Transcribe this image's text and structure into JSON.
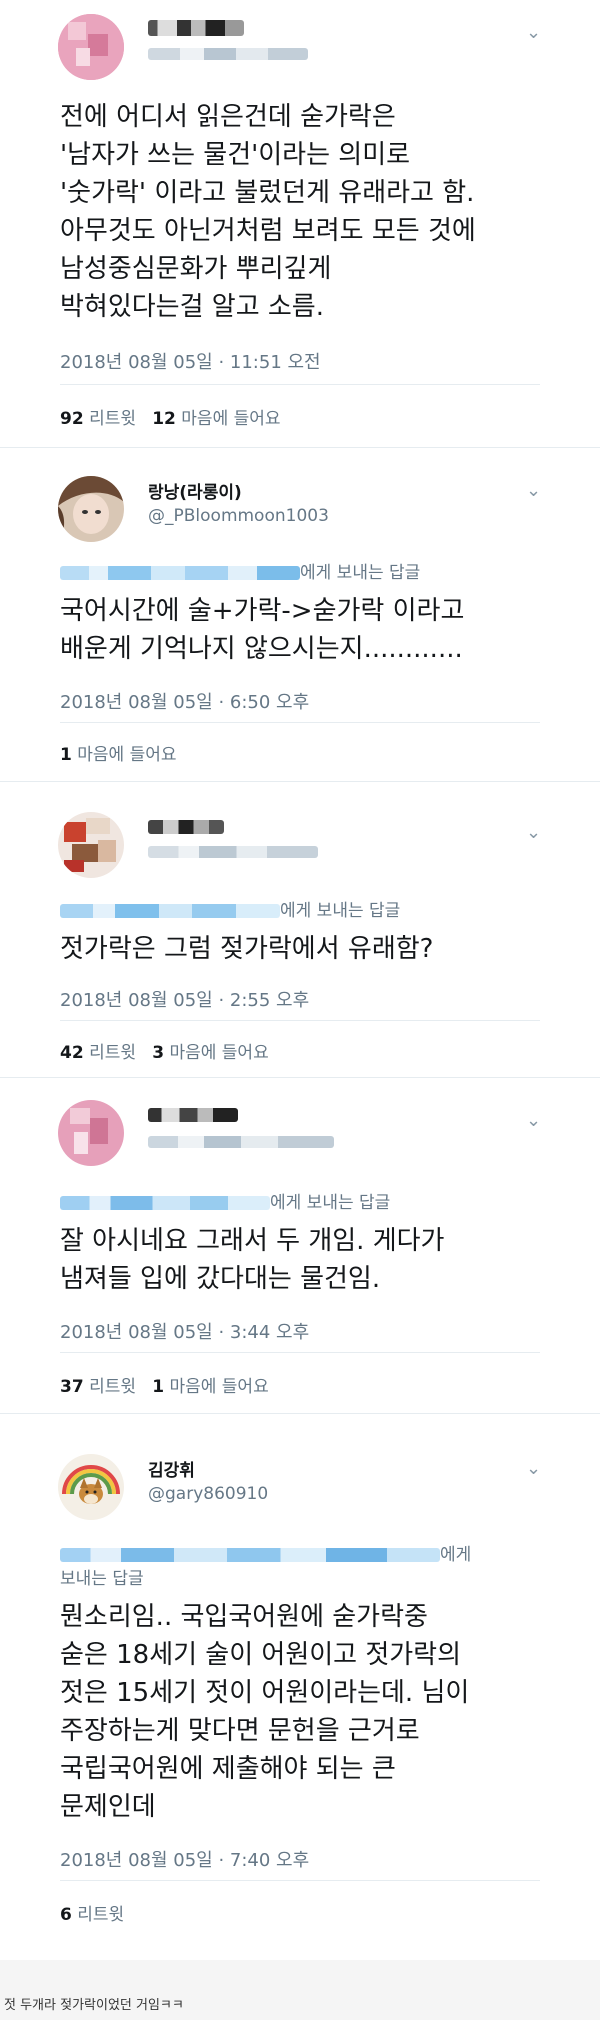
{
  "tweets": [
    {
      "name": "",
      "handle": "",
      "reply_to_suffix": "",
      "lines": [
        "전에 어디서 읽은건데 숟가락은",
        "'남자가 쓰는 물건'이라는 의미로",
        "'숫가락' 이라고 불렀던게 유래라고 함.",
        "아무것도 아닌거처럼 보려도 모든 것에",
        "남성중심문화가 뿌리깊게",
        "박혀있다는걸 알고 소름."
      ],
      "date": "2018년 08월 05일 · 11:51 오전",
      "retweets": "92",
      "retweets_label": "리트윗",
      "likes": "12",
      "likes_label": "마음에 들어요"
    },
    {
      "name": "랑낭(라롱이)",
      "handle": "@_PBloommoon1003",
      "reply_to_suffix": "에게 보내는 답글",
      "lines": [
        "국어시간에 술+가락->숟가락 이라고",
        "배운게 기억나지 않으시는지............"
      ],
      "date": "2018년 08월 05일 · 6:50 오후",
      "likes": "1",
      "likes_label": "마음에 들어요"
    },
    {
      "name": "",
      "handle": "",
      "reply_to_suffix": "에게 보내는 답글",
      "lines": [
        "젓가락은  그럼  젖가락에서 유래함?"
      ],
      "date": "2018년 08월 05일 · 2:55 오후",
      "retweets": "42",
      "retweets_label": "리트윗",
      "likes": "3",
      "likes_label": "마음에 들어요"
    },
    {
      "name": "",
      "handle": "",
      "reply_to_suffix": "에게 보내는 답글",
      "lines": [
        "잘 아시네요 그래서 두 개임. 게다가",
        "냄져들 입에 갔다대는 물건임."
      ],
      "date": "2018년 08월 05일 · 3:44 오후",
      "retweets": "37",
      "retweets_label": "리트윗",
      "likes": "1",
      "likes_label": "마음에 들어요"
    },
    {
      "name": "김강휘",
      "handle": "@gary860910",
      "reply_to_suffix": "에게",
      "reply_to_line2": "보내는 답글",
      "lines": [
        "뭔소리임.. 국입국어원에 숟가락중",
        "숟은 18세기 술이 어원이고 젓가락의",
        "젓은 15세기 젓이 어원이라는데. 님이",
        "주장하는게 맞다면 문헌을 근거로",
        "국립국어원에 제출해야 되는 큰",
        "문제인데"
      ],
      "date": "2018년 08월 05일 · 7:40 오후",
      "retweets": "6",
      "retweets_label": "리트윗"
    }
  ],
  "caption": "젓 두개라 젖가락이었던 거임ㅋㅋ",
  "icons": {
    "more": "chevron-down-icon"
  },
  "colors": {
    "text": "#14171a",
    "secondary": "#657786",
    "link": "#1da1f2",
    "divider": "#e6ecf0"
  }
}
